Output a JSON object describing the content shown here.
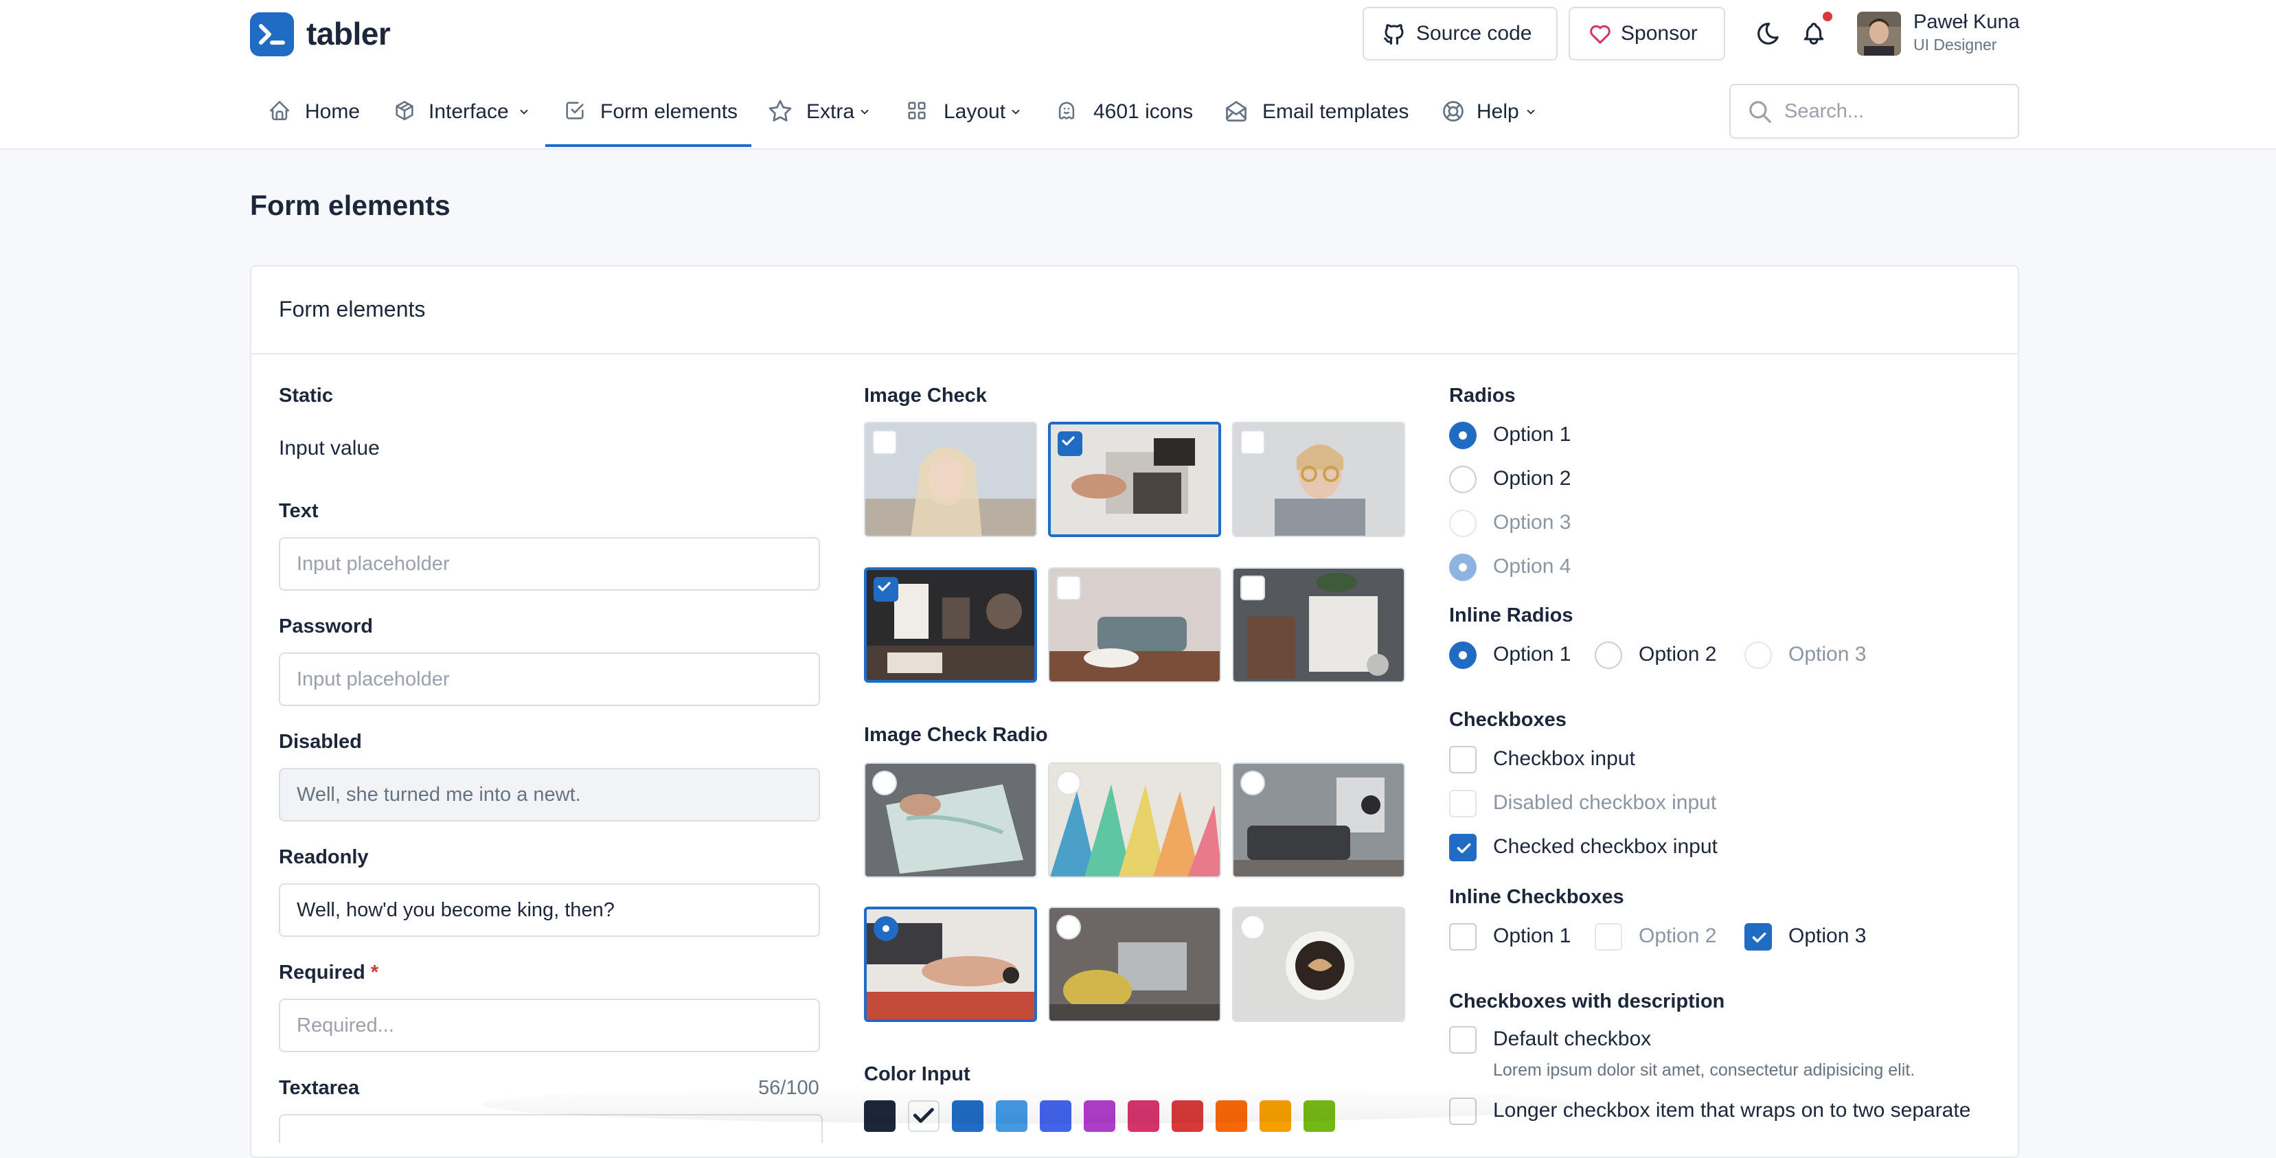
{
  "brand": {
    "name": "tabler"
  },
  "header": {
    "source_code_label": "Source code",
    "sponsor_label": "Sponsor",
    "user": {
      "name": "Paweł Kuna",
      "role": "UI Designer"
    }
  },
  "nav": {
    "items": [
      {
        "label": "Home",
        "icon": "home-icon"
      },
      {
        "label": "Interface",
        "icon": "package-icon",
        "dropdown": true
      },
      {
        "label": "Form elements",
        "icon": "checkbox-icon",
        "active": true
      },
      {
        "label": "Extra",
        "icon": "star-icon",
        "dropdown": true
      },
      {
        "label": "Layout",
        "icon": "layout-grid-icon",
        "dropdown": true
      },
      {
        "label": "4601 icons",
        "icon": "ghost-icon"
      },
      {
        "label": "Email templates",
        "icon": "mail-opened-icon"
      },
      {
        "label": "Help",
        "icon": "lifebuoy-icon",
        "dropdown": true
      }
    ],
    "search_placeholder": "Search..."
  },
  "page": {
    "title": "Form elements"
  },
  "card": {
    "title": "Form elements"
  },
  "form": {
    "static_label": "Static",
    "static_value": "Input value",
    "text_label": "Text",
    "text_placeholder": "Input placeholder",
    "password_label": "Password",
    "password_placeholder": "Input placeholder",
    "disabled_label": "Disabled",
    "disabled_value": "Well, she turned me into a newt.",
    "readonly_label": "Readonly",
    "readonly_value": "Well, how'd you become king, then?",
    "required_label": "Required",
    "required_star": "*",
    "required_placeholder": "Required...",
    "textarea_label": "Textarea",
    "textarea_counter": "56/100"
  },
  "image_check": {
    "label": "Image Check",
    "checked": [
      false,
      true,
      false,
      true,
      false,
      false
    ]
  },
  "image_check_radio": {
    "label": "Image Check Radio",
    "selected_index": 3
  },
  "color_input": {
    "label": "Color Input",
    "colors": [
      "#1d273b",
      "#ffffff",
      "#206bc4",
      "#4299e1",
      "#4263eb",
      "#ae3ec9",
      "#d6336c",
      "#d63939",
      "#f76707",
      "#f59f00",
      "#74b816"
    ],
    "selected_index": 1
  },
  "radios": {
    "label": "Radios",
    "options": [
      {
        "label": "Option 1",
        "checked": true,
        "disabled": false
      },
      {
        "label": "Option 2",
        "checked": false,
        "disabled": false
      },
      {
        "label": "Option 3",
        "checked": false,
        "disabled": true
      },
      {
        "label": "Option 4",
        "checked": true,
        "disabled": true
      }
    ]
  },
  "inline_radios": {
    "label": "Inline Radios",
    "options": [
      {
        "label": "Option 1",
        "checked": true
      },
      {
        "label": "Option 2",
        "checked": false
      },
      {
        "label": "Option 3",
        "checked": false,
        "disabled": true
      }
    ]
  },
  "checkboxes": {
    "label": "Checkboxes",
    "options": [
      {
        "label": "Checkbox input",
        "checked": false
      },
      {
        "label": "Disabled checkbox input",
        "checked": false,
        "disabled": true
      },
      {
        "label": "Checked checkbox input",
        "checked": true
      }
    ]
  },
  "inline_checkboxes": {
    "label": "Inline Checkboxes",
    "options": [
      {
        "label": "Option 1",
        "checked": false
      },
      {
        "label": "Option 2",
        "checked": false,
        "disabled": true
      },
      {
        "label": "Option 3",
        "checked": true
      }
    ]
  },
  "checkboxes_desc": {
    "label": "Checkboxes with description",
    "items": [
      {
        "label": "Default checkbox",
        "description": "Lorem ipsum dolor sit amet, consectetur adipisicing elit."
      },
      {
        "label": "Longer checkbox item that wraps on to two separate"
      }
    ]
  }
}
